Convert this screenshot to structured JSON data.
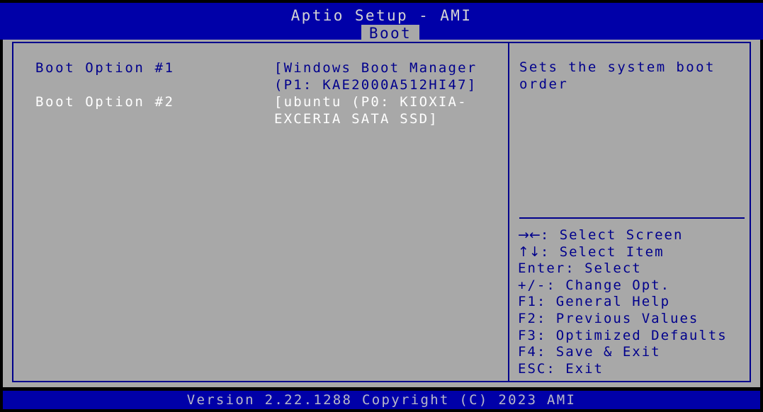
{
  "header": {
    "title": "Aptio Setup - AMI",
    "tabs": [
      {
        "label": "Boot",
        "active": true
      }
    ]
  },
  "main": {
    "options": [
      {
        "label": "Boot Option #1",
        "value": "[Windows Boot Manager (P1: KAE2000A512HI47]",
        "selected": true
      },
      {
        "label": "Boot Option #2",
        "value": "[ubuntu (P0: KIOXIA-EXCERIA SATA SSD]",
        "selected": false
      }
    ]
  },
  "help": {
    "description": "Sets the system boot order",
    "legend": [
      {
        "key": "→←",
        "text": ": Select Screen"
      },
      {
        "key": "↑↓",
        "text": ": Select Item"
      },
      {
        "key": "Enter",
        "text": ": Select"
      },
      {
        "key": "+/-",
        "text": ": Change Opt."
      },
      {
        "key": "F1",
        "text": ": General Help"
      },
      {
        "key": "F2",
        "text": ": Previous Values"
      },
      {
        "key": "F3",
        "text": ": Optimized Defaults"
      },
      {
        "key": "F4",
        "text": ": Save & Exit"
      },
      {
        "key": "ESC",
        "text": ": Exit"
      }
    ]
  },
  "footer": {
    "version_text": "Version 2.22.1288 Copyright (C) 2023 AMI"
  },
  "colors": {
    "background_blue": "#0000a8",
    "panel_gray": "#a8a8a8",
    "accent_blue": "#00008c",
    "text_white": "#ffffff",
    "title_text": "#d4d4d4"
  }
}
